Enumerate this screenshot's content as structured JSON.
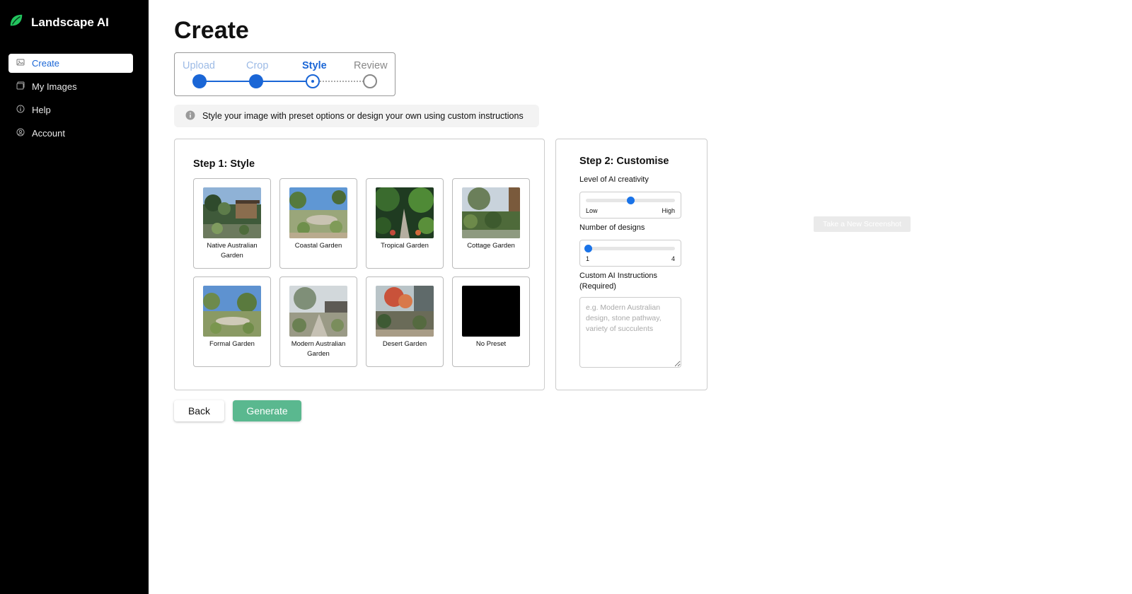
{
  "brand": {
    "name": "Landscape AI",
    "icon": "leaf-icon",
    "accent": "#22c55e"
  },
  "sidebar": {
    "items": [
      {
        "label": "Create",
        "icon": "image-icon",
        "active": true
      },
      {
        "label": "My Images",
        "icon": "gallery-icon",
        "active": false
      },
      {
        "label": "Help",
        "icon": "info-icon",
        "active": false
      },
      {
        "label": "Account",
        "icon": "user-circle-icon",
        "active": false
      }
    ]
  },
  "page": {
    "title": "Create"
  },
  "stepper": {
    "steps": [
      {
        "label": "Upload",
        "state": "done"
      },
      {
        "label": "Crop",
        "state": "done"
      },
      {
        "label": "Style",
        "state": "current"
      },
      {
        "label": "Review",
        "state": "pending"
      }
    ]
  },
  "info": {
    "icon": "info-icon",
    "text": "Style your image with preset options or design your own using custom instructions"
  },
  "style_card": {
    "heading": "Step 1: Style",
    "presets": [
      {
        "label": "Native Australian Garden",
        "thumb": "native-australian-garden-photo"
      },
      {
        "label": "Coastal Garden",
        "thumb": "coastal-garden-photo"
      },
      {
        "label": "Tropical Garden",
        "thumb": "tropical-garden-photo"
      },
      {
        "label": "Cottage Garden",
        "thumb": "cottage-garden-photo"
      },
      {
        "label": "Formal Garden",
        "thumb": "formal-garden-photo"
      },
      {
        "label": "Modern Australian Garden",
        "thumb": "modern-australian-garden-photo"
      },
      {
        "label": "Desert Garden",
        "thumb": "desert-garden-photo"
      },
      {
        "label": "No Preset",
        "thumb": "black-swatch"
      }
    ]
  },
  "customise": {
    "heading": "Step 2: Customise",
    "creativity": {
      "label": "Level of AI creativity",
      "min_label": "Low",
      "max_label": "High",
      "value": 0.5
    },
    "designs": {
      "label": "Number of designs",
      "min_label": "1",
      "max_label": "4",
      "value": 1
    },
    "instructions": {
      "label": "Custom AI Instructions (Required)",
      "placeholder": "e.g. Modern Australian design, stone pathway, variety of succulents",
      "value": ""
    }
  },
  "buttons": {
    "back": "Back",
    "generate": "Generate"
  },
  "overlay": {
    "screenshot_button": "Take a New Screenshot"
  },
  "colors": {
    "primary": "#1a66d6",
    "generate": "#5ab88f",
    "sidebar_bg": "#000000"
  }
}
